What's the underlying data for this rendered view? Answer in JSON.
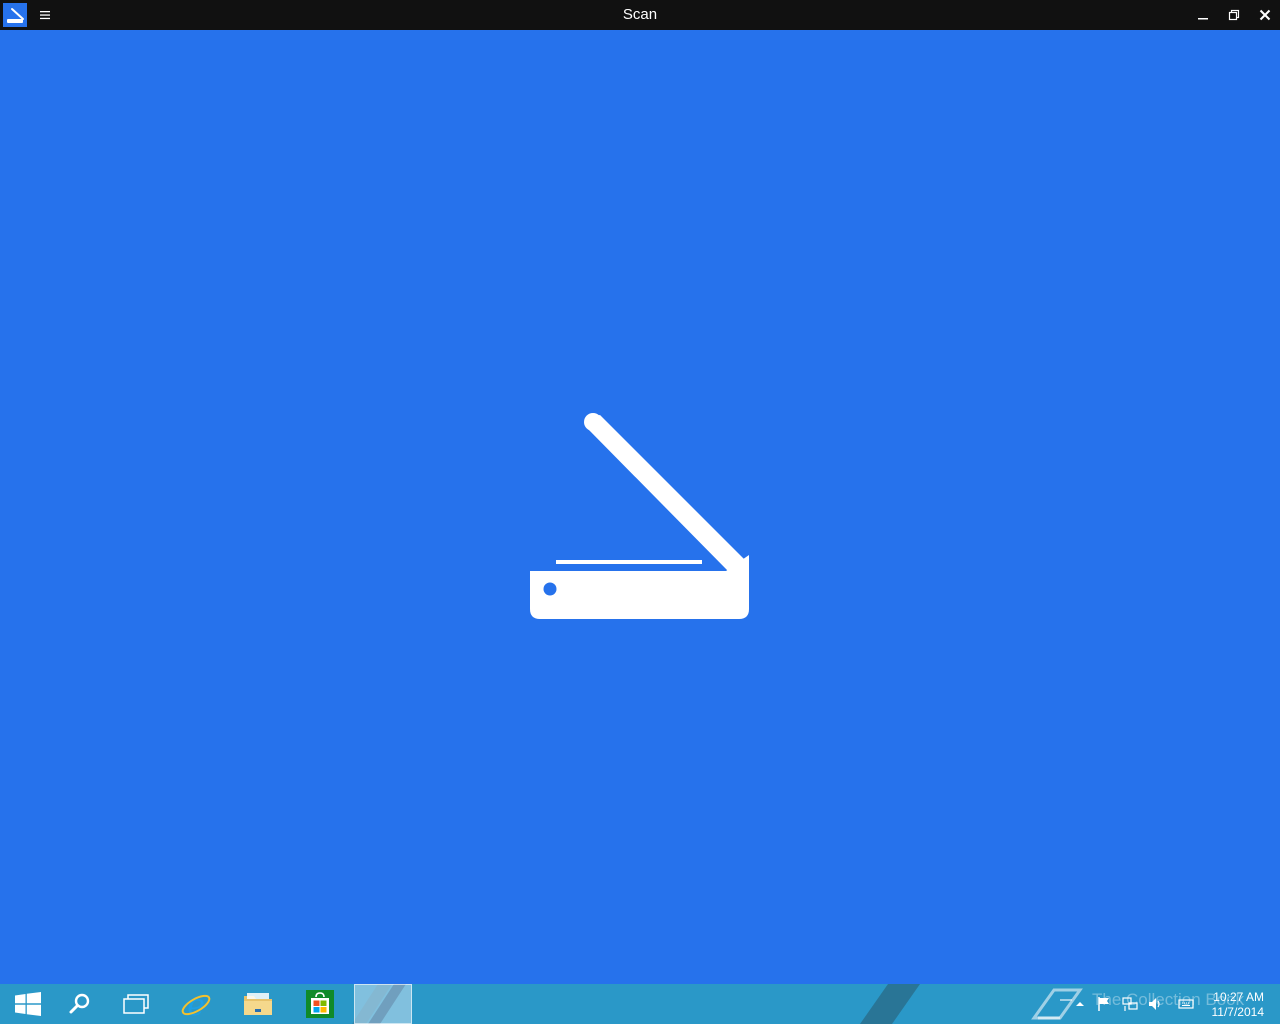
{
  "window": {
    "title": "Scan",
    "app_icon": "scan-app-icon",
    "menu_icon": "hamburger-menu-icon",
    "controls": {
      "minimize_icon": "minimize-icon",
      "maximize_icon": "restore-icon",
      "close_icon": "close-icon"
    }
  },
  "main": {
    "background_color": "#2672ec",
    "splash_icon": "scanner-icon"
  },
  "taskbar": {
    "background_color": "#2a98c8",
    "pinned": [
      {
        "name": "start-button",
        "icon": "windows-logo-icon"
      },
      {
        "name": "search-button",
        "icon": "search-icon"
      },
      {
        "name": "task-view-button",
        "icon": "task-view-icon"
      },
      {
        "name": "internet-explorer-button",
        "icon": "internet-explorer-icon"
      },
      {
        "name": "file-explorer-button",
        "icon": "folder-icon"
      },
      {
        "name": "store-button",
        "icon": "store-icon"
      },
      {
        "name": "scan-app-button",
        "icon": "scan-app-icon",
        "active": true
      }
    ],
    "tray": {
      "icons": [
        "show-hidden-icons-icon",
        "action-center-flag-icon",
        "network-icon",
        "volume-icon",
        "keyboard-icon"
      ]
    },
    "watermark": "The Collection Book",
    "clock": {
      "time": "10:27 AM",
      "date": "11/7/2014"
    }
  }
}
